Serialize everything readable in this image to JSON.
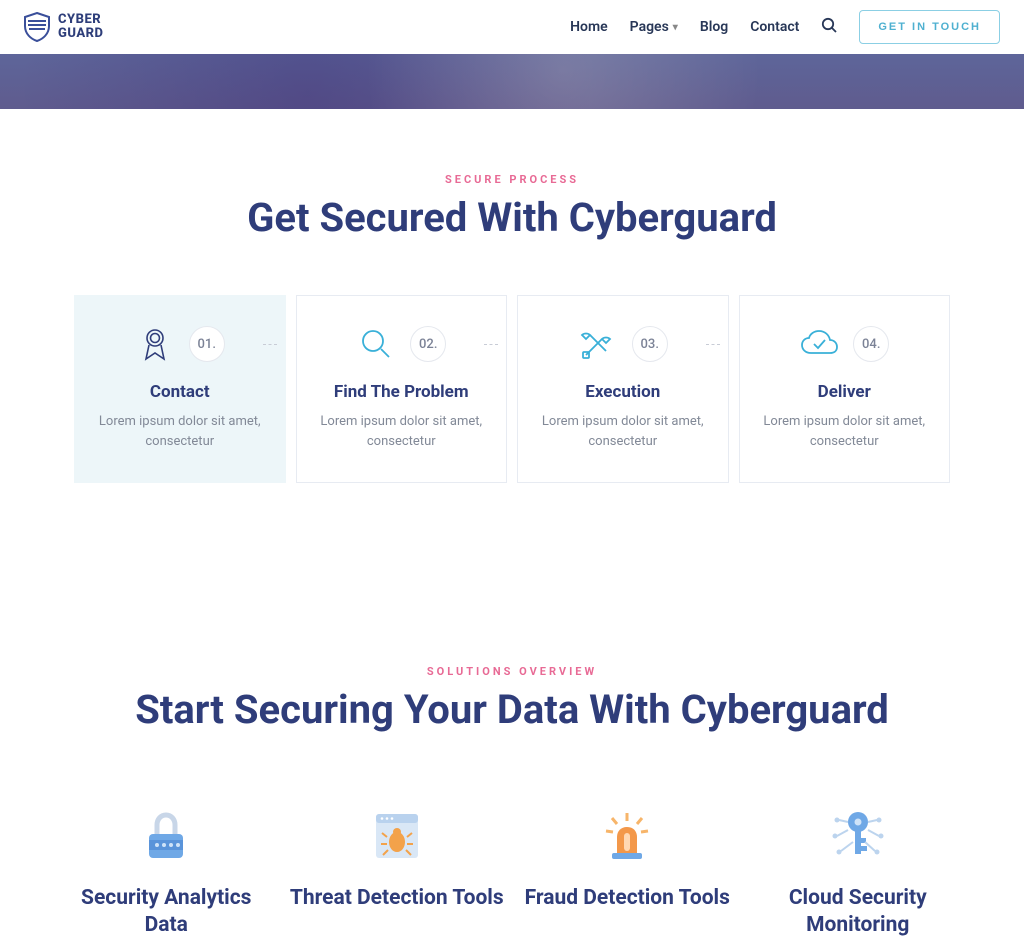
{
  "brand": {
    "line1": "CYBER",
    "line2": "GUARD"
  },
  "nav": {
    "home": "Home",
    "pages": "Pages",
    "blog": "Blog",
    "contact": "Contact"
  },
  "cta": "GET IN TOUCH",
  "process": {
    "eyebrow": "SECURE PROCESS",
    "title": "Get Secured With Cyberguard",
    "steps": [
      {
        "num": "01.",
        "title": "Contact",
        "desc": "Lorem ipsum dolor sit amet, consectetur"
      },
      {
        "num": "02.",
        "title": "Find The Problem",
        "desc": "Lorem ipsum dolor sit amet, consectetur"
      },
      {
        "num": "03.",
        "title": "Execution",
        "desc": "Lorem ipsum dolor sit amet, consectetur"
      },
      {
        "num": "04.",
        "title": "Deliver",
        "desc": "Lorem ipsum dolor sit amet, consectetur"
      }
    ]
  },
  "solutions": {
    "eyebrow": "SOLUTIONS OVERVIEW",
    "title": "Start Securing Your Data With Cyberguard",
    "items": [
      {
        "title": "Security Analytics Data"
      },
      {
        "title": "Threat Detection Tools"
      },
      {
        "title": "Fraud Detection Tools"
      },
      {
        "title": "Cloud Security Monitoring"
      }
    ]
  }
}
